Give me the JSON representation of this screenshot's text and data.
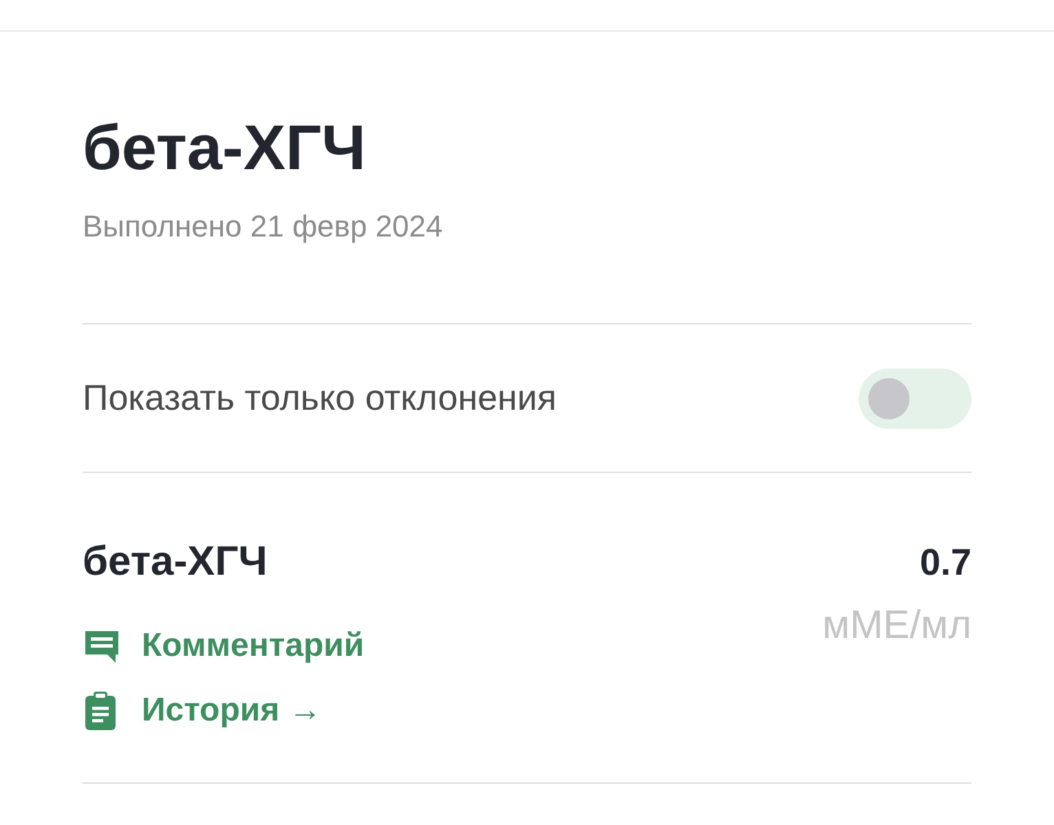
{
  "header": {
    "title": "бета-ХГЧ",
    "completed": "Выполнено 21 февр 2024"
  },
  "filter": {
    "label": "Показать только отклонения",
    "on": false
  },
  "results": [
    {
      "name": "бета-ХГЧ",
      "value": "0.7",
      "unit": "мМЕ/мл",
      "links": [
        {
          "kind": "comment",
          "label": "Комментарий"
        },
        {
          "kind": "history",
          "label": "История →"
        }
      ]
    }
  ]
}
